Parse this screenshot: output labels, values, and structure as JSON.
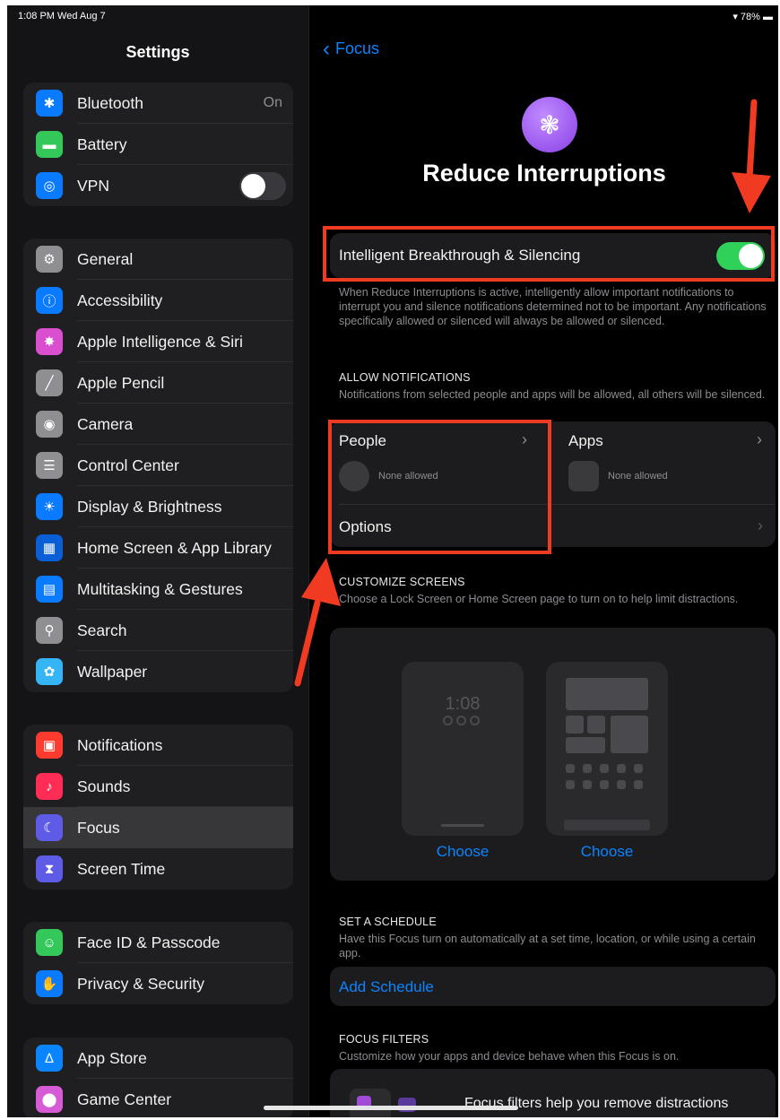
{
  "status_bar": {
    "time_date": "1:08 PM  Wed Aug 7",
    "battery": "▾ 78% ▬"
  },
  "sidebar": {
    "title": "Settings",
    "group1": [
      {
        "label": "Bluetooth",
        "icon": "bluetooth-icon",
        "glyph": "✱",
        "color": "#0a7aff",
        "value": "On"
      },
      {
        "label": "Battery",
        "icon": "battery-icon",
        "glyph": "▬",
        "color": "#34c759"
      },
      {
        "label": "VPN",
        "icon": "vpn-icon",
        "glyph": "◎",
        "color": "#0a7aff",
        "toggle": "off"
      }
    ],
    "group2": [
      {
        "label": "General",
        "icon": "gear-icon",
        "glyph": "⚙",
        "color": "#8e8e93"
      },
      {
        "label": "Accessibility",
        "icon": "accessibility-icon",
        "glyph": "ⓘ",
        "color": "#0a7aff"
      },
      {
        "label": "Apple Intelligence & Siri",
        "icon": "siri-icon",
        "glyph": "✸",
        "color": "#d94fd0"
      },
      {
        "label": "Apple Pencil",
        "icon": "pencil-icon",
        "glyph": "╱",
        "color": "#8e8e93"
      },
      {
        "label": "Camera",
        "icon": "camera-icon",
        "glyph": "◉",
        "color": "#8e8e93"
      },
      {
        "label": "Control Center",
        "icon": "control-center-icon",
        "glyph": "☰",
        "color": "#8e8e93"
      },
      {
        "label": "Display & Brightness",
        "icon": "brightness-icon",
        "glyph": "☀",
        "color": "#0a7aff"
      },
      {
        "label": "Home Screen & App Library",
        "icon": "home-screen-icon",
        "glyph": "▦",
        "color": "#0a5fd6"
      },
      {
        "label": "Multitasking & Gestures",
        "icon": "multitasking-icon",
        "glyph": "▤",
        "color": "#0a7aff"
      },
      {
        "label": "Search",
        "icon": "search-icon",
        "glyph": "⚲",
        "color": "#8e8e93"
      },
      {
        "label": "Wallpaper",
        "icon": "wallpaper-icon",
        "glyph": "✿",
        "color": "#35b5f5"
      }
    ],
    "group3": [
      {
        "label": "Notifications",
        "icon": "notifications-icon",
        "glyph": "▣",
        "color": "#ff3b30"
      },
      {
        "label": "Sounds",
        "icon": "sounds-icon",
        "glyph": "♪",
        "color": "#ff2d55"
      },
      {
        "label": "Focus",
        "icon": "moon-icon",
        "glyph": "☾",
        "color": "#5e5ce6",
        "selected": true
      },
      {
        "label": "Screen Time",
        "icon": "hourglass-icon",
        "glyph": "⧗",
        "color": "#5e5ce6"
      }
    ],
    "group4": [
      {
        "label": "Face ID & Passcode",
        "icon": "face-id-icon",
        "glyph": "☺",
        "color": "#34c759"
      },
      {
        "label": "Privacy & Security",
        "icon": "hand-icon",
        "glyph": "✋",
        "color": "#0a7aff"
      }
    ],
    "group5": [
      {
        "label": "App Store",
        "icon": "app-store-icon",
        "glyph": "∆",
        "color": "#0a84ff"
      },
      {
        "label": "Game Center",
        "icon": "game-center-icon",
        "glyph": "⬤",
        "color": "#d55cd5"
      }
    ]
  },
  "main": {
    "back_label": "Focus",
    "focus_icon": "reduce-interruptions-icon",
    "title": "Reduce Interruptions",
    "intelligent_label": "Intelligent Breakthrough & Silencing",
    "intelligent_toggle": "on",
    "intelligent_footer": "When Reduce Interruptions is active, intelligently allow important notifications to interrupt you and silence notifications determined not to be important. Any notifications specifically allowed or silenced will always be allowed or silenced.",
    "allow_header": "ALLOW NOTIFICATIONS",
    "allow_desc": "Notifications from selected people and apps will be allowed, all others will be silenced.",
    "people_label": "People",
    "people_value": "None allowed",
    "apps_label": "Apps",
    "apps_value": "None allowed",
    "options_label": "Options",
    "customize_header": "CUSTOMIZE SCREENS",
    "customize_desc": "Choose a Lock Screen or Home Screen page to turn on to help limit distractions.",
    "lock_time": "1:08",
    "choose_lock": "Choose",
    "choose_home": "Choose",
    "schedule_header": "SET A SCHEDULE",
    "schedule_desc": "Have this Focus turn on automatically at a set time, location, or while using a certain app.",
    "add_schedule": "Add Schedule",
    "filters_header": "FOCUS FILTERS",
    "filters_desc": "Customize how your apps and device behave when this Focus is on.",
    "filters_text": "Focus filters help you remove distractions"
  },
  "colors": {
    "accent": "#0a84ff",
    "toggle_on": "#30d158",
    "annotation": "#f03a22"
  }
}
